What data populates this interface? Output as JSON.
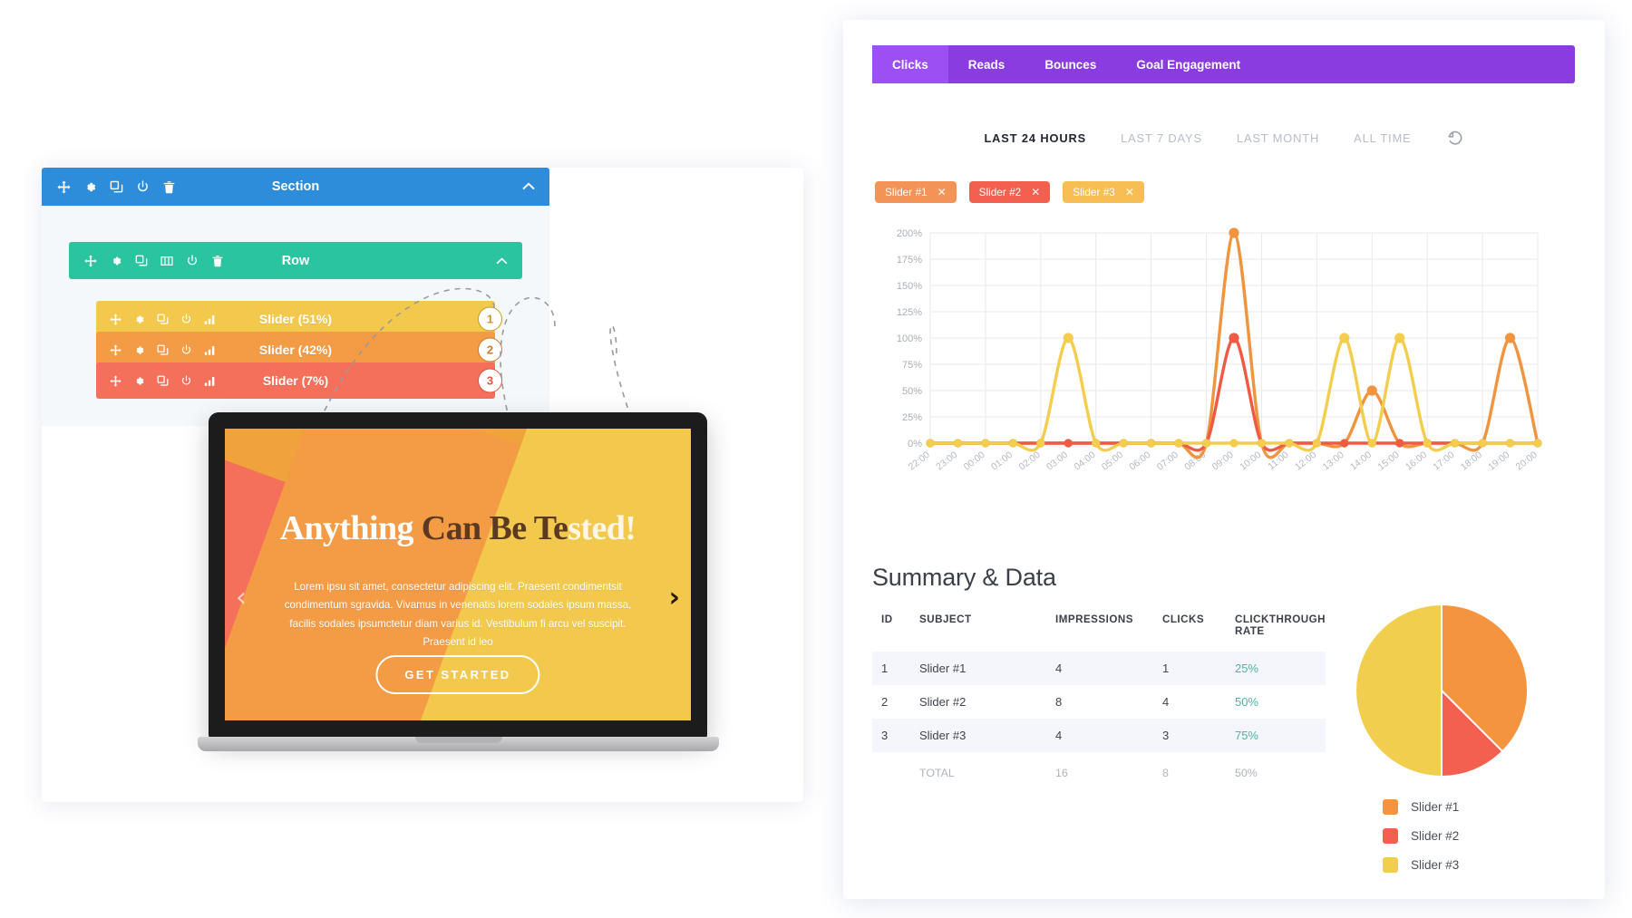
{
  "builder": {
    "section": {
      "label": "Section",
      "color": "#2d8ddb",
      "icons": [
        "move-icon",
        "gear-icon",
        "duplicate-icon",
        "power-icon",
        "trash-icon"
      ]
    },
    "row": {
      "label": "Row",
      "color": "#2ac4a1",
      "icons": [
        "move-icon",
        "gear-icon",
        "duplicate-icon",
        "columns-icon",
        "power-icon",
        "trash-icon"
      ]
    },
    "modules": [
      {
        "label": "Slider (51%)",
        "badge": "1",
        "color": "#f2c94c",
        "badge_color": "#c79a22"
      },
      {
        "label": "Slider (42%)",
        "badge": "2",
        "color": "#f49b46",
        "badge_color": "#d4782a"
      },
      {
        "label": "Slider (7%)",
        "badge": "3",
        "color": "#f4705a",
        "badge_color": "#de5442"
      }
    ],
    "module_icons": [
      "move-icon",
      "gear-icon",
      "duplicate-icon",
      "power-icon",
      "stats-icon"
    ]
  },
  "slide": {
    "heading_a": "Anything",
    "heading_b": " Can Be Te",
    "heading_c": "sted!",
    "body": "Lorem ipsu sit amet, consectetur adipiscing elit. Praesent condimentsit condimentum sgravida. Vivamus in venenatis lorem sodales ipsum massa, facilis sodales ipsumctetur diam varius id. Vestibulum fi arcu vel suscipit. Praesent id leo",
    "cta_a": "GET STAR",
    "cta_b": "TED",
    "prev_icon": "chevron-left-icon",
    "next_icon": "chevron-right-icon",
    "band_colors": [
      "#f4705a",
      "#f49b46",
      "#f2c94c"
    ]
  },
  "panel": {
    "tabs": [
      {
        "label": "Clicks",
        "active": true
      },
      {
        "label": "Reads",
        "active": false
      },
      {
        "label": "Bounces",
        "active": false
      },
      {
        "label": "Goal Engagement",
        "active": false
      }
    ],
    "tabbar_color": "#8b3ce0",
    "tab_active_color": "#9c4ff2",
    "ranges": [
      {
        "label": "LAST 24 HOURS",
        "active": true
      },
      {
        "label": "LAST 7 DAYS",
        "active": false
      },
      {
        "label": "LAST MONTH",
        "active": false
      },
      {
        "label": "ALL TIME",
        "active": false
      }
    ],
    "reset_icon": "reset-icon",
    "chips": [
      {
        "label": "Slider #1",
        "color": "#f49357",
        "close_icon": "close-icon"
      },
      {
        "label": "Slider #2",
        "color": "#f4604f",
        "close_icon": "close-icon"
      },
      {
        "label": "Slider #3",
        "color": "#f7bf53",
        "close_icon": "close-icon"
      }
    ]
  },
  "summary": {
    "title": "Summary & Data",
    "columns": [
      "ID",
      "SUBJECT",
      "IMPRESSIONS",
      "CLICKS",
      "CLICKTHROUGH RATE"
    ],
    "rows": [
      {
        "id": "1",
        "subject": "Slider #1",
        "impressions": "4",
        "clicks": "1",
        "ctr": "25%"
      },
      {
        "id": "2",
        "subject": "Slider #2",
        "impressions": "8",
        "clicks": "4",
        "ctr": "50%"
      },
      {
        "id": "3",
        "subject": "Slider #3",
        "impressions": "4",
        "clicks": "3",
        "ctr": "75%"
      }
    ],
    "total": {
      "label": "TOTAL",
      "impressions": "16",
      "clicks": "8",
      "ctr": "50%"
    },
    "ctr_color": "#4cb5a5"
  },
  "chart_data": [
    {
      "type": "line",
      "title": "",
      "xlabel": "",
      "ylabel": "",
      "ylim": [
        0,
        200
      ],
      "yticks": [
        "0%",
        "25%",
        "50%",
        "75%",
        "100%",
        "125%",
        "150%",
        "175%",
        "200%"
      ],
      "grid": true,
      "legend": "none",
      "x": [
        "22:00",
        "23:00",
        "00:00",
        "01:00",
        "02:00",
        "03:00",
        "04:00",
        "05:00",
        "06:00",
        "07:00",
        "08:00",
        "09:00",
        "10:00",
        "11:00",
        "12:00",
        "13:00",
        "14:00",
        "15:00",
        "16:00",
        "17:00",
        "18:00",
        "19:00",
        "20:00"
      ],
      "series": [
        {
          "name": "Slider #1",
          "color": "#f0943f",
          "values": [
            0,
            0,
            0,
            0,
            0,
            0,
            0,
            0,
            0,
            0,
            0,
            200,
            0,
            0,
            0,
            0,
            50,
            0,
            0,
            0,
            0,
            100,
            0
          ]
        },
        {
          "name": "Slider #2",
          "color": "#ef5a45",
          "values": [
            0,
            0,
            0,
            0,
            0,
            0,
            0,
            0,
            0,
            0,
            0,
            100,
            0,
            0,
            0,
            0,
            0,
            0,
            0,
            0,
            0,
            0,
            0
          ]
        },
        {
          "name": "Slider #3",
          "color": "#f3ce4e",
          "values": [
            0,
            0,
            0,
            0,
            0,
            100,
            0,
            0,
            0,
            0,
            0,
            0,
            0,
            0,
            0,
            100,
            0,
            100,
            0,
            0,
            0,
            0,
            0
          ]
        }
      ]
    },
    {
      "type": "pie",
      "title": "",
      "labels": [
        "Slider #1",
        "Slider #2",
        "Slider #3"
      ],
      "values": [
        37.5,
        12.5,
        50
      ],
      "colors": [
        "#f4943f",
        "#f4604f",
        "#f2ce4e"
      ],
      "legend": "bottom"
    }
  ]
}
